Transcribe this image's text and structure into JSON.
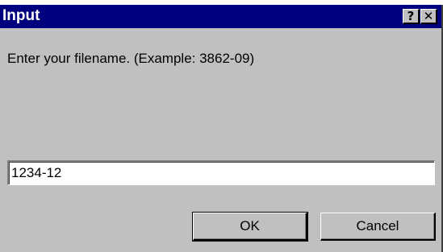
{
  "window": {
    "title": "Input",
    "help_label": "?",
    "close_label": "✕"
  },
  "prompt": {
    "text": "Enter your filename. (Example: 3862-09)"
  },
  "filename_input": {
    "value": "1234-12"
  },
  "buttons": {
    "ok_label": "OK",
    "cancel_label": "Cancel"
  }
}
